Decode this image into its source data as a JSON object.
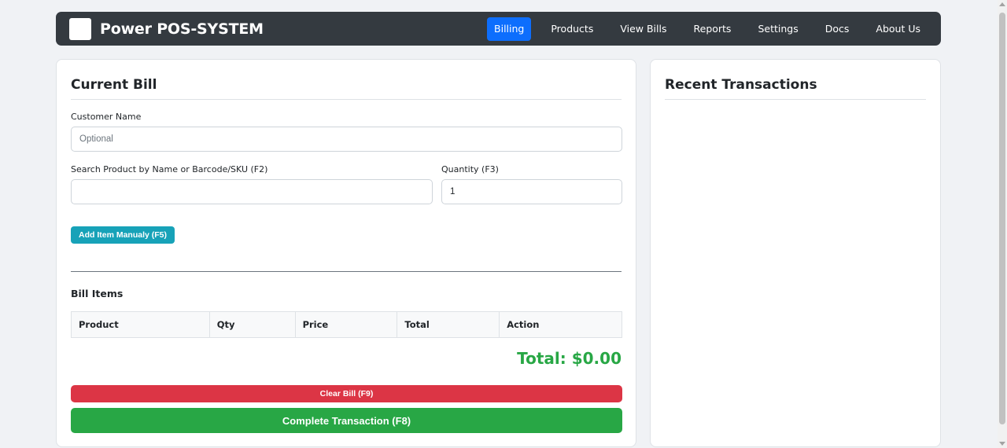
{
  "app": {
    "brand": "Power POS-SYSTEM"
  },
  "nav": {
    "items": [
      {
        "label": "Billing",
        "active": true
      },
      {
        "label": "Products"
      },
      {
        "label": "View Bills"
      },
      {
        "label": "Reports"
      },
      {
        "label": "Settings"
      },
      {
        "label": "Docs"
      },
      {
        "label": "About Us"
      }
    ]
  },
  "bill": {
    "title": "Current Bill",
    "customer": {
      "label": "Customer Name",
      "placeholder": "Optional",
      "value": ""
    },
    "search": {
      "label": "Search Product by Name or Barcode/SKU (F2)",
      "value": ""
    },
    "quantity": {
      "label": "Quantity (F3)",
      "value": "1"
    },
    "add_button": "Add Item Manualy (F5)",
    "items_title": "Bill Items",
    "columns": [
      "Product",
      "Qty",
      "Price",
      "Total",
      "Action"
    ],
    "total_text": "Total: $0.00",
    "clear_button": "Clear Bill (F9)",
    "complete_button": "Complete Transaction (F8)"
  },
  "recent": {
    "title": "Recent Transactions"
  },
  "colors": {
    "navbar": "#343a40",
    "active_nav": "#0d6efd",
    "info": "#17a2b8",
    "danger": "#dc3545",
    "success": "#28a745"
  }
}
